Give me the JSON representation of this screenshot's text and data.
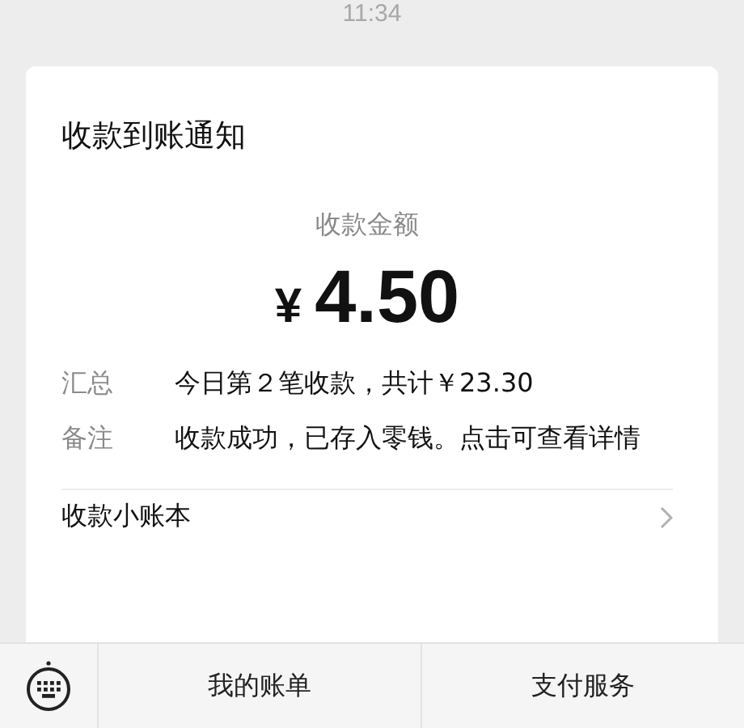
{
  "status_time": "11:34",
  "card": {
    "title": "收款到账通知",
    "amount_label": "收款金额",
    "currency": "¥",
    "amount": "4.50",
    "rows": [
      {
        "label": "汇总",
        "value": "今日第２笔收款，共计￥23.30"
      },
      {
        "label": "备注",
        "value": "收款成功，已存入零钱。点击可查看详情"
      }
    ],
    "link": {
      "label": "收款小账本"
    }
  },
  "bottom_bar": {
    "items": [
      "我的账单",
      "支付服务"
    ]
  }
}
